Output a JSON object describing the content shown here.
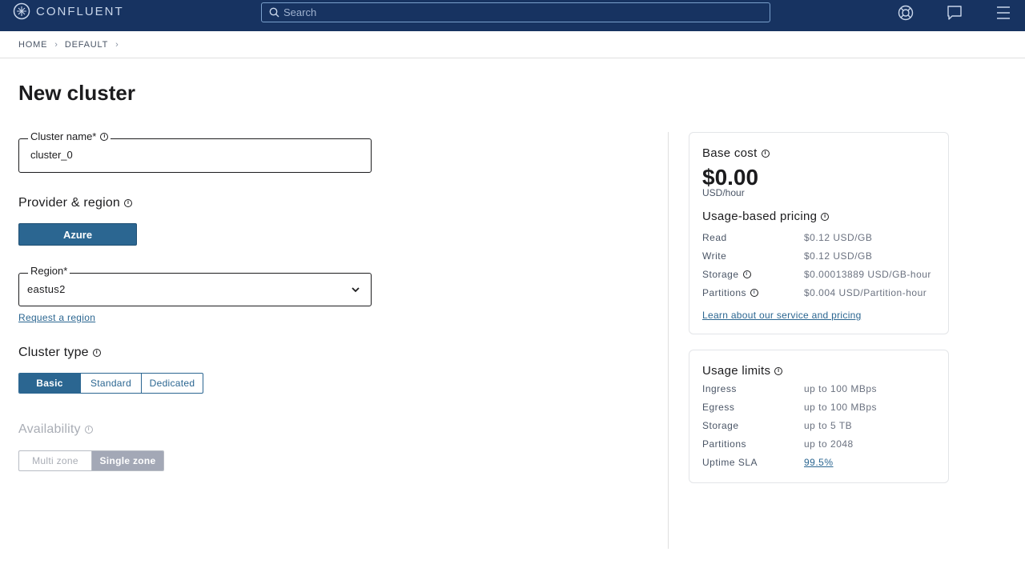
{
  "header": {
    "brand": "CONFLUENT",
    "search_placeholder": "Search",
    "icons": [
      "help-lifebuoy-icon",
      "chat-icon",
      "menu-icon"
    ]
  },
  "breadcrumb": {
    "items": [
      "HOME",
      "DEFAULT"
    ]
  },
  "page": {
    "title": "New cluster"
  },
  "form": {
    "cluster_name_label": "Cluster name*",
    "cluster_name_value": "cluster_0",
    "provider_title": "Provider & region",
    "provider_selected": "Azure",
    "region_label": "Region*",
    "region_value": "eastus2",
    "request_region_link": "Request a region",
    "cluster_type_title": "Cluster type",
    "cluster_types": [
      "Basic",
      "Standard",
      "Dedicated"
    ],
    "cluster_type_selected": "Basic",
    "availability_title": "Availability",
    "availability_options": [
      "Multi zone",
      "Single zone"
    ],
    "availability_selected": "Single zone"
  },
  "cost_card": {
    "base_cost_title": "Base cost",
    "base_cost_value": "$0.00",
    "base_cost_unit": "USD/hour",
    "usage_title": "Usage-based pricing",
    "rows": [
      {
        "label": "Read",
        "value": "$0.12 USD/GB"
      },
      {
        "label": "Write",
        "value": "$0.12 USD/GB"
      },
      {
        "label": "Storage",
        "value": "$0.00013889 USD/GB-hour"
      },
      {
        "label": "Partitions",
        "value": "$0.004 USD/Partition-hour"
      }
    ],
    "learn_link": "Learn about our service and pricing"
  },
  "limits_card": {
    "title": "Usage limits",
    "rows": [
      {
        "label": "Ingress",
        "value": "up to 100 MBps"
      },
      {
        "label": "Egress",
        "value": "up to 100 MBps"
      },
      {
        "label": "Storage",
        "value": "up to 5 TB"
      },
      {
        "label": "Partitions",
        "value": "up to 2048"
      },
      {
        "label": "Uptime SLA",
        "value": "99.5%"
      }
    ]
  },
  "colors": {
    "header_bg": "#173361",
    "accent": "#2b6691",
    "disabled_selected": "#a3a8b6"
  }
}
